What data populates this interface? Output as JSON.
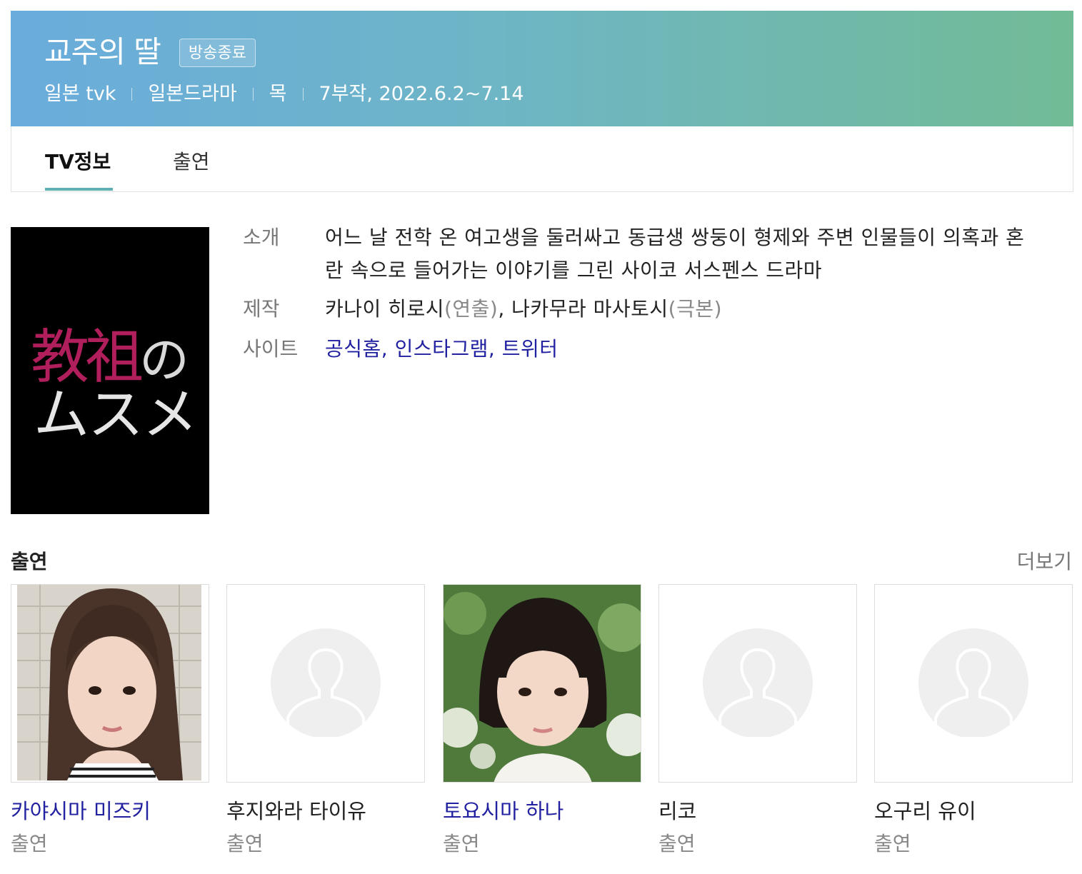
{
  "header": {
    "title": "교주의 딸",
    "badge": "방송종료",
    "meta": [
      "일본 tvk",
      "일본드라마",
      "목",
      "7부작, 2022.6.2~7.14"
    ]
  },
  "tabs": [
    {
      "label": "TV정보",
      "active": true
    },
    {
      "label": "출연",
      "active": false
    }
  ],
  "poster": {
    "line1_kanji": "教祖",
    "line1_kana": "の",
    "line2": "ムスメ"
  },
  "info": {
    "intro": {
      "label": "소개",
      "text": "어느 날 전학 온 여고생을 둘러싸고 동급생 쌍둥이 형제와 주변 인물들이 의혹과 혼란 속으로 들어가는 이야기를 그린 사이코 서스펜스 드라마"
    },
    "production": {
      "label": "제작",
      "person1": "카나이 히로시",
      "role1": "(연출)",
      "sep": ", ",
      "person2": "나카무라 마사토시",
      "role2": "(극본)"
    },
    "site": {
      "label": "사이트",
      "links": [
        "공식홈",
        "인스타그램",
        "트위터"
      ],
      "sep": ", "
    }
  },
  "cast": {
    "title": "출연",
    "more": "더보기",
    "members": [
      {
        "name": "카야시마 미즈키",
        "role": "출연",
        "has_photo": true,
        "linked": true
      },
      {
        "name": "후지와라 타이유",
        "role": "출연",
        "has_photo": false,
        "linked": false
      },
      {
        "name": "토요시마 하나",
        "role": "출연",
        "has_photo": true,
        "linked": true
      },
      {
        "name": "리코",
        "role": "출연",
        "has_photo": false,
        "linked": false
      },
      {
        "name": "오구리 유이",
        "role": "출연",
        "has_photo": false,
        "linked": false
      }
    ]
  },
  "colors": {
    "banner_start": "#6aacdc",
    "banner_end": "#72bb96",
    "tab_underline": "#5fb0b5",
    "link": "#2020a0",
    "poster_red": "#b01e5c"
  }
}
